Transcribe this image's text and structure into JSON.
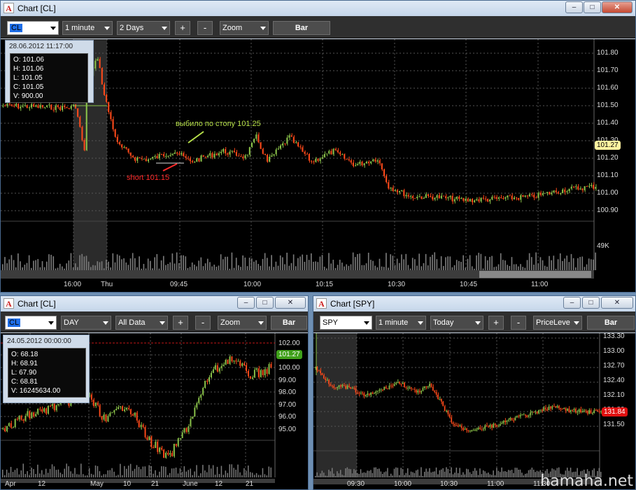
{
  "top": {
    "title": "Chart [CL]",
    "symbol": "CL",
    "interval": "1 minute",
    "range": "2 Days",
    "plus": "+",
    "minus": "-",
    "zoom": "Zoom",
    "bar": "Bar",
    "info": {
      "datetime": "28.06.2012 11:17:00",
      "o": "O: 101.06",
      "h": "H: 101.06",
      "l": "L: 101.05",
      "c": "C: 101.05",
      "v": "V: 900.00"
    },
    "prices": [
      "101.80",
      "101.70",
      "101.60",
      "101.50",
      "101.40",
      "101.30",
      "101.20",
      "101.10",
      "101.00",
      "100.90"
    ],
    "last_price": "101.27",
    "volume_label": "49K",
    "xlabels": [
      "16:00",
      "Thu",
      "09:45",
      "10:00",
      "10:15",
      "10:30",
      "10:45",
      "11:00"
    ],
    "annot_stop": "выбило по стопу 101.25",
    "annot_short": "short 101.15"
  },
  "bl": {
    "title": "Chart [CL]",
    "symbol": "CL",
    "interval": "DAY",
    "range": "All Data",
    "plus": "+",
    "minus": "-",
    "zoom": "Zoom",
    "bar": "Bar",
    "info": {
      "datetime": "24.05.2012 00:00:00",
      "o": "O: 68.18",
      "h": "H: 68.91",
      "l": "L: 67.90",
      "c": "C: 68.81",
      "v": "V: 16245634.00"
    },
    "prices": [
      "102.00",
      "101.00",
      "100.00",
      "99.00",
      "98.00",
      "97.00",
      "96.00",
      "95.00"
    ],
    "last_price": "101.27",
    "xlabels": [
      "Apr",
      "12",
      "May",
      "10",
      "21",
      "June",
      "12",
      "21"
    ]
  },
  "br": {
    "title": "Chart [SPY]",
    "symbol": "SPY",
    "interval": "1 minute",
    "range": "Today",
    "plus": "+",
    "minus": "-",
    "indicator": "PriceLeve",
    "bar": "Bar",
    "prices": [
      "133.30",
      "133.00",
      "132.70",
      "132.40",
      "132.10",
      "131.80",
      "131.50"
    ],
    "last_price": "131.84",
    "xlabels": [
      "09:30",
      "10:00",
      "10:30",
      "11:00",
      "11:30"
    ]
  },
  "watermark": "hamaha.net",
  "colors": {
    "up": "#8bc34a",
    "down": "#ff4a1a",
    "accent": "#1e6ee8",
    "grid": "#555555"
  }
}
